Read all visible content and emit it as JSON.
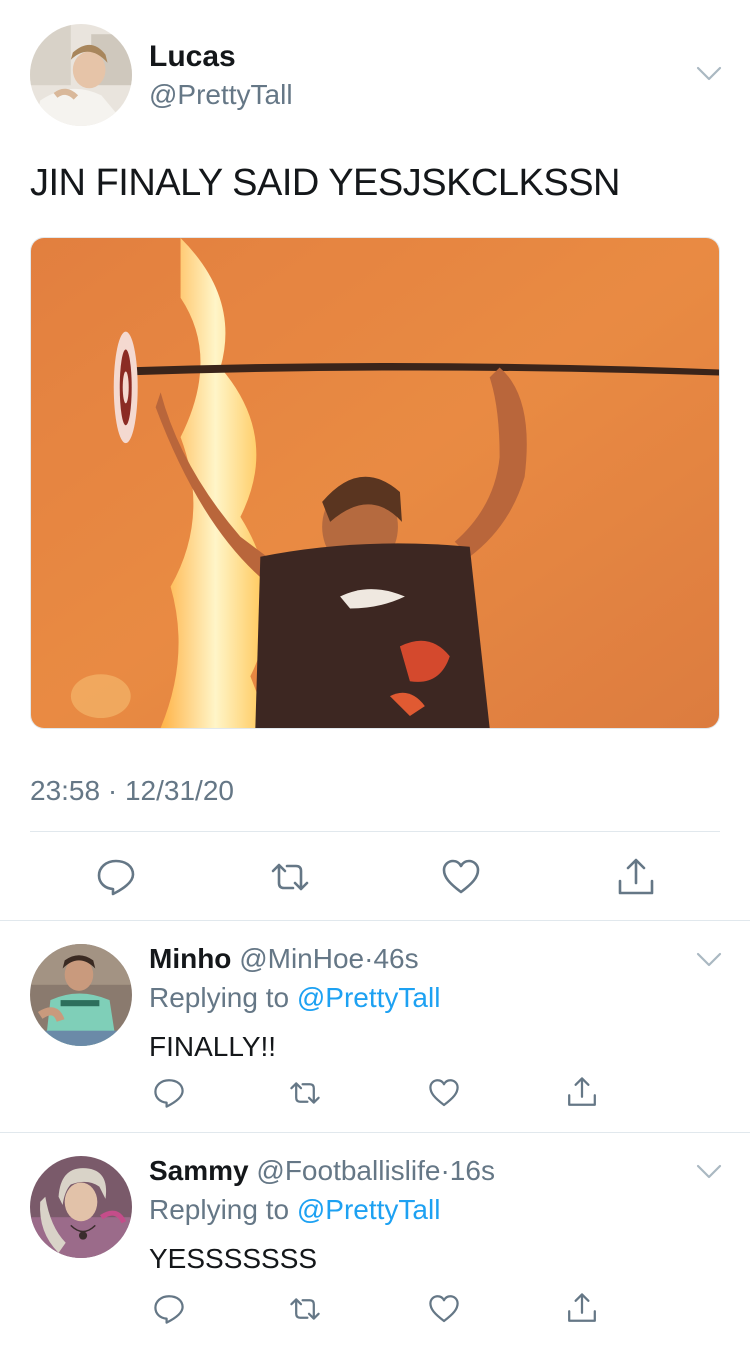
{
  "main_tweet": {
    "author_name": "Lucas",
    "author_handle": "@PrettyTall",
    "text": "JIN FINALY SAID YESJSKCLKSSN",
    "time": "23:58",
    "separator": "·",
    "date": "12/31/20",
    "icons": {
      "menu": "chevron-down-icon",
      "reply": "reply-icon",
      "retweet": "retweet-icon",
      "like": "heart-icon",
      "share": "share-icon"
    }
  },
  "replies": [
    {
      "author_name": "Minho",
      "author_handle": "@MinHoe",
      "separator": "·",
      "time_ago": "46s",
      "replying_prefix": "Replying to",
      "replying_to": "@PrettyTall",
      "text": "FINALLY!!"
    },
    {
      "author_name": "Sammy",
      "author_handle": "@Footballislife",
      "separator": "·",
      "time_ago": "16s",
      "replying_prefix": "Replying to",
      "replying_to": "@PrettyTall",
      "text": "YESSSSSSS"
    }
  ],
  "colors": {
    "text_primary": "#14171a",
    "text_secondary": "#657786",
    "link": "#1da1f2",
    "divider": "#e1e8ed",
    "icon": "#657786"
  }
}
